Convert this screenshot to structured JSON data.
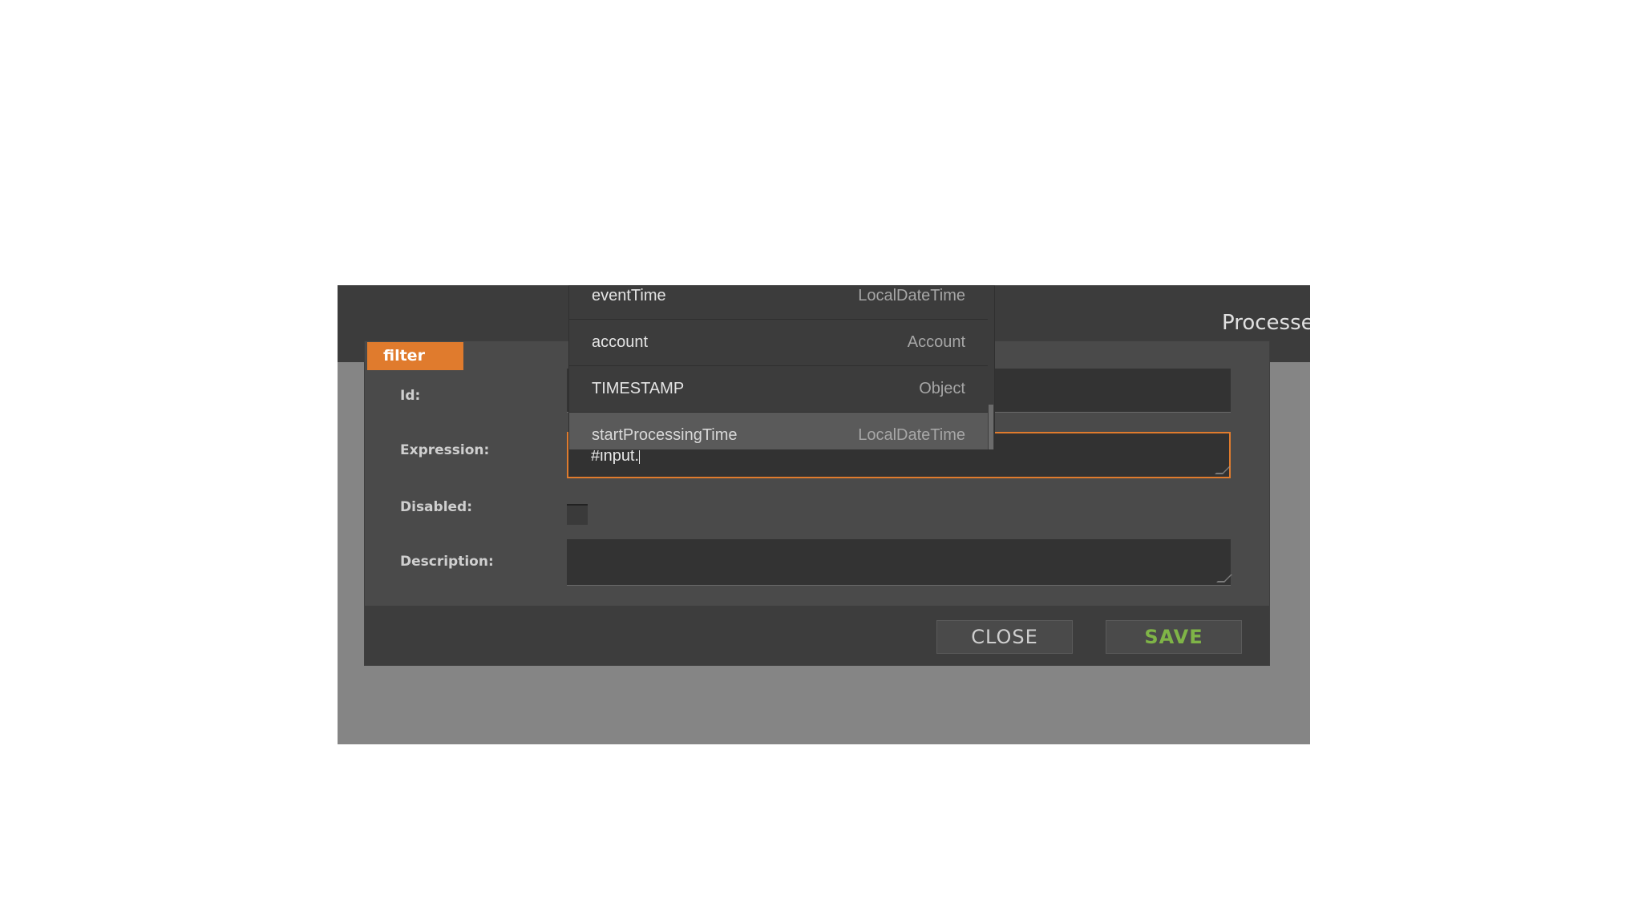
{
  "header": {
    "title": "Processe"
  },
  "modal": {
    "node_type": "filter",
    "fields": {
      "id_label": "Id:",
      "id_value": "",
      "expression_label": "Expression:",
      "expression_value": "#input.",
      "disabled_label": "Disabled:",
      "disabled_checked": false,
      "description_label": "Description:",
      "description_value": ""
    },
    "buttons": {
      "close": "CLOSE",
      "save": "SAVE"
    }
  },
  "autocomplete": {
    "items": [
      {
        "name": "eventTime",
        "type": "LocalDateTime"
      },
      {
        "name": "account",
        "type": "Account"
      },
      {
        "name": "TIMESTAMP",
        "type": "Object"
      },
      {
        "name": "startProcessingTime",
        "type": "LocalDateTime",
        "selected": true
      }
    ]
  },
  "colors": {
    "accent": "#e07b2d",
    "save_text": "#7fb447",
    "overlay": "#858585",
    "modal_bg": "#4a4a4a"
  }
}
